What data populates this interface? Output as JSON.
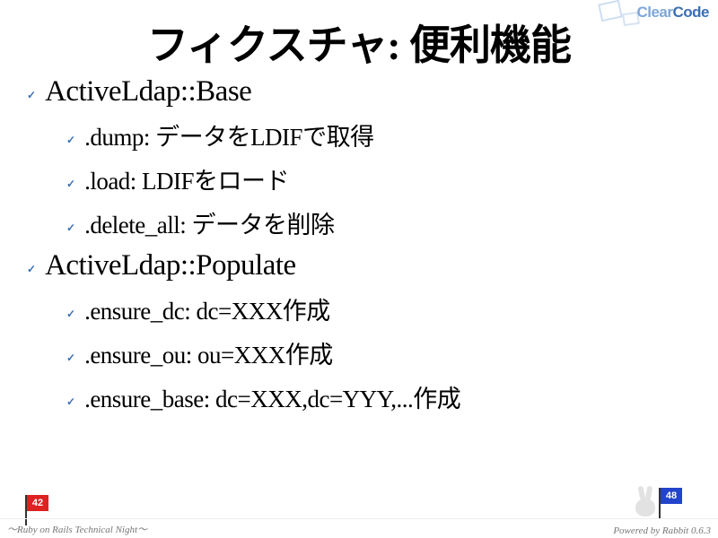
{
  "logo": {
    "text_left": "Clear",
    "text_right": "Code"
  },
  "title": "フィクスチャ: 便利機能",
  "bullets": [
    {
      "label": "ActiveLdap::Base",
      "children": [
        {
          "label": ".dump: データをLDIFで取得"
        },
        {
          "label": ".load: LDIFをロード"
        },
        {
          "label": ".delete_all: データを削除"
        }
      ]
    },
    {
      "label": "ActiveLdap::Populate",
      "children": [
        {
          "label": ".ensure_dc: dc=XXX作成"
        },
        {
          "label": ".ensure_ou: ou=XXX作成"
        },
        {
          "label": ".ensure_base: dc=XXX,dc=YYY,...作成"
        }
      ]
    }
  ],
  "flags": {
    "left": "42",
    "right": "48"
  },
  "footer": {
    "left": "〜Ruby on Rails Technical Night〜",
    "right": "Powered by Rabbit 0.6.3"
  }
}
